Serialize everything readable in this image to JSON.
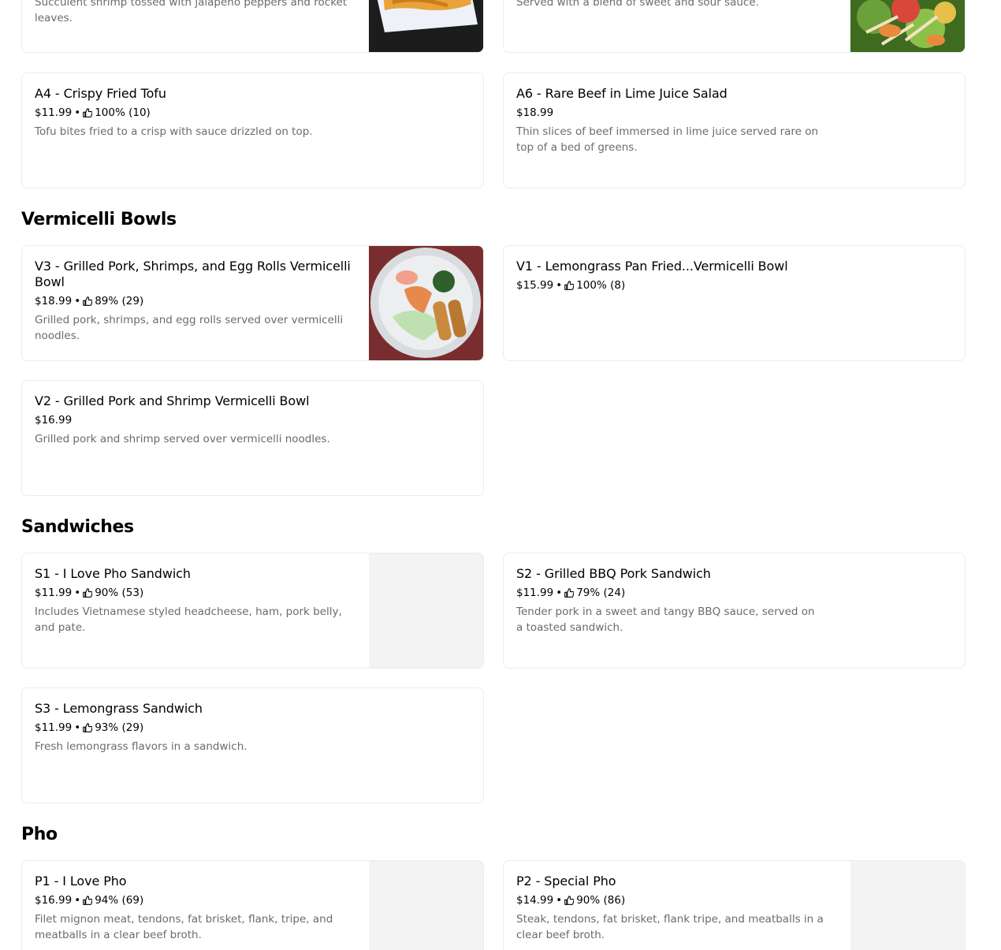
{
  "appetizers_partial": {
    "left_card": {
      "desc": "Succulent shrimp tossed with jalapeño peppers and rocket leaves."
    },
    "right_card": {
      "desc": "Eight pieces of shrimp dipped in batter and fried to a crisp. Served with a blend of sweet and sour sauce."
    },
    "a4": {
      "title": "A4 - Crispy Fried Tofu",
      "price": "$11.99",
      "rating": "100% (10)",
      "desc": "Tofu bites fried to a crisp with sauce drizzled on top."
    },
    "a6": {
      "title": "A6 - Rare Beef in Lime Juice Salad",
      "price": "$18.99",
      "desc": "Thin slices of beef immersed in lime juice served rare on top of a bed of greens."
    }
  },
  "sections": {
    "vermicelli": {
      "title": "Vermicelli Bowls",
      "v3": {
        "title": "V3 - Grilled Pork, Shrimps, and Egg Rolls Vermicelli Bowl",
        "price": "$18.99",
        "rating": "89% (29)",
        "desc": "Grilled pork, shrimps, and egg rolls served over vermicelli noodles."
      },
      "v1": {
        "title": "V1 - Lemongrass Pan Fried...Vermicelli Bowl",
        "price": "$15.99",
        "rating": "100% (8)"
      },
      "v2": {
        "title": "V2 - Grilled Pork and Shrimp Vermicelli Bowl",
        "price": "$16.99",
        "desc": "Grilled pork and shrimp served over vermicelli noodles."
      }
    },
    "sandwiches": {
      "title": "Sandwiches",
      "s1": {
        "title": "S1 - I Love Pho Sandwich",
        "price": "$11.99",
        "rating": "90% (53)",
        "desc": "Includes Vietnamese styled headcheese, ham, pork belly, and pate."
      },
      "s2": {
        "title": "S2 - Grilled BBQ Pork Sandwich",
        "price": "$11.99",
        "rating": "79% (24)",
        "desc": "Tender pork in a sweet and tangy BBQ sauce, served on a toasted sandwich."
      },
      "s3": {
        "title": "S3 - Lemongrass Sandwich",
        "price": "$11.99",
        "rating": "93% (29)",
        "desc": "Fresh lemongrass flavors in a sandwich."
      }
    },
    "pho": {
      "title": "Pho",
      "p1": {
        "title": "P1 - I Love Pho",
        "price": "$16.99",
        "rating": "94% (69)",
        "desc": "Filet mignon meat, tendons, fat brisket, flank, tripe, and meatballs in a clear beef broth."
      },
      "p2": {
        "title": "P2 - Special Pho",
        "price": "$14.99",
        "rating": "90% (86)",
        "desc": "Steak, tendons, fat brisket, flank tripe, and meatballs in a clear beef broth."
      }
    }
  },
  "meta_separator": "•",
  "icons": {
    "rating": "thumbs-up-icon"
  },
  "colors": {
    "text": "#000000",
    "secondary_text": "#6b6b6b",
    "card_border": "#ececec",
    "image_placeholder": "#f3f3f3"
  }
}
